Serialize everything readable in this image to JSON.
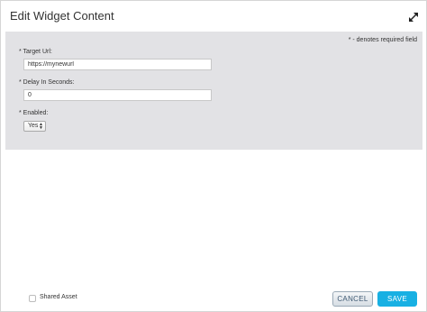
{
  "dialog": {
    "title": "Edit Widget Content"
  },
  "form": {
    "required_note": "* - denotes required field",
    "target_url": {
      "label": "* Target Url:",
      "value": "https://mynewurl"
    },
    "delay": {
      "label": "* Delay In Seconds:",
      "value": "0"
    },
    "enabled": {
      "label": "* Enabled:",
      "selected": "Yes"
    }
  },
  "footer": {
    "shared_asset_label": "Shared Asset",
    "shared_asset_checked": false,
    "cancel_label": "CANCEL",
    "save_label": "SAVE"
  },
  "colors": {
    "panel_background": "#e2e2e5",
    "save_button": "#18b0e3",
    "cancel_text": "#3f5a73"
  },
  "icons": {
    "expand": "expand-arrows-icon",
    "select_arrows": "up-down-arrows-icon"
  }
}
